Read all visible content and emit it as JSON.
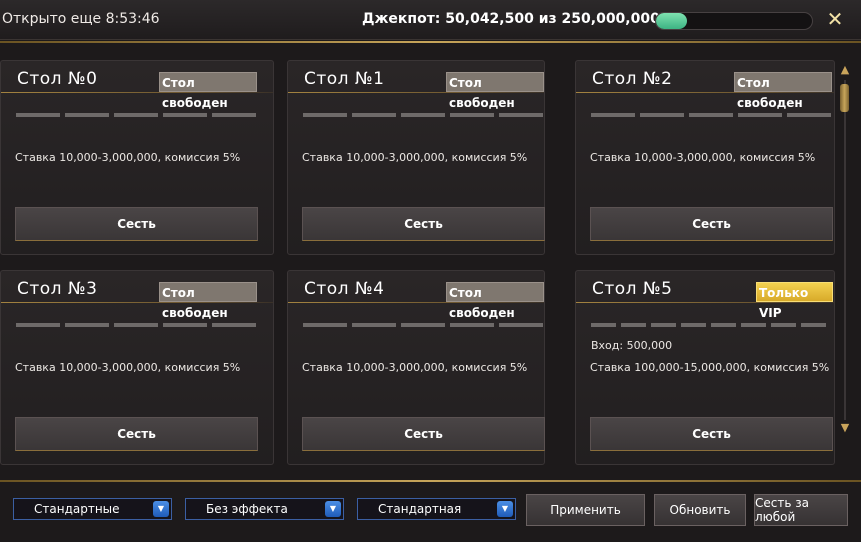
{
  "header": {
    "timer": "Открыто еще 8:53:46",
    "jackpot": "Джекпот: 50,042,500 из 250,000,000",
    "jackpot_progress": 0.2,
    "close_icon": "close-icon",
    "colors": {
      "progress": "#4cc995",
      "gold": "#c7a55a"
    }
  },
  "tables": [
    {
      "title": "Стол №0",
      "status": "Стол свободен",
      "stake": "Ставка 10,000-3,000,000, комиссия 5%",
      "sit_label": "Сесть",
      "seats": 5
    },
    {
      "title": "Стол №1",
      "status": "Стол свободен",
      "stake": "Ставка 10,000-3,000,000, комиссия 5%",
      "sit_label": "Сесть",
      "seats": 5
    },
    {
      "title": "Стол №2",
      "status": "Стол свободен",
      "stake": "Ставка 10,000-3,000,000, комиссия 5%",
      "sit_label": "Сесть",
      "seats": 5
    },
    {
      "title": "Стол №3",
      "status": "Стол свободен",
      "stake": "Ставка 10,000-3,000,000, комиссия 5%",
      "sit_label": "Сесть",
      "seats": 5
    },
    {
      "title": "Стол №4",
      "status": "Стол свободен",
      "stake": "Ставка 10,000-3,000,000, комиссия 5%",
      "sit_label": "Сесть",
      "seats": 5
    },
    {
      "title": "Стол №5",
      "status": "Только VIP",
      "entry": "Вход: 500,000",
      "stake": "Ставка 100,000-15,000,000, комиссия 5%",
      "sit_label": "Сесть",
      "seats": 8,
      "vip": true
    }
  ],
  "filters": {
    "select1": "Стандартные",
    "select2": "Без эффекта",
    "select3": "Стандартная"
  },
  "buttons": {
    "apply": "Применить",
    "refresh": "Обновить",
    "sit_any": "Сесть за любой"
  }
}
